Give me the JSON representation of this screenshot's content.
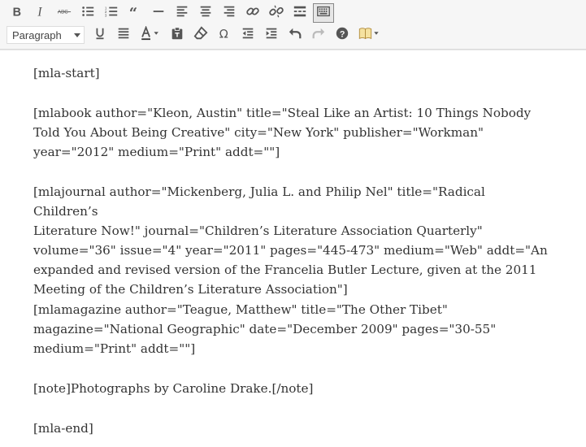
{
  "toolbar": {
    "format_select": "Paragraph",
    "row1": [
      "bold-icon",
      "italic-icon",
      "strikethrough-icon",
      "bullet-list-icon",
      "numbered-list-icon",
      "blockquote-icon",
      "horizontal-line-icon",
      "align-left-icon",
      "align-center-icon",
      "align-right-icon",
      "link-icon",
      "unlink-icon",
      "read-more-icon",
      "toolbar-toggle-icon"
    ],
    "row2": [
      "underline-icon",
      "justify-icon",
      "text-color-icon",
      "paste-as-text-icon",
      "clear-formatting-icon",
      "special-character-icon",
      "outdent-icon",
      "indent-icon",
      "undo-icon",
      "redo-icon",
      "help-icon",
      "book-icon"
    ]
  },
  "editor": {
    "paragraphs": [
      "[mla-start]",
      "[mlabook author=\"Kleon, Austin\" title=\"Steal Like an Artist: 10 Things Nobody\nTold You About Being Creative\" city=\"New York\" publisher=\"Workman\"\nyear=\"2012\" medium=\"Print\" addt=\"\"]",
      "[mlajournal author=\"Mickenberg, Julia L. and Philip Nel\" title=\"Radical Children’s\nLiterature Now!\" journal=\"Children’s Literature Association Quarterly\"\nvolume=\"36\" issue=\"4\" year=\"2011\" pages=\"445-473\" medium=\"Web\" addt=\"An\nexpanded and revised version of the Francelia Butler Lecture, given at the 2011\nMeeting of the Children’s Literature Association\"]",
      "[mlamagazine author=\"Teague, Matthew\" title=\"The Other Tibet\"\nmagazine=\"National Geographic\" date=\"December 2009\" pages=\"30-55\"\nmedium=\"Print\" addt=\"\"]",
      "[note]Photographs by Caroline Drake.[/note]",
      "[mla-end]"
    ]
  }
}
